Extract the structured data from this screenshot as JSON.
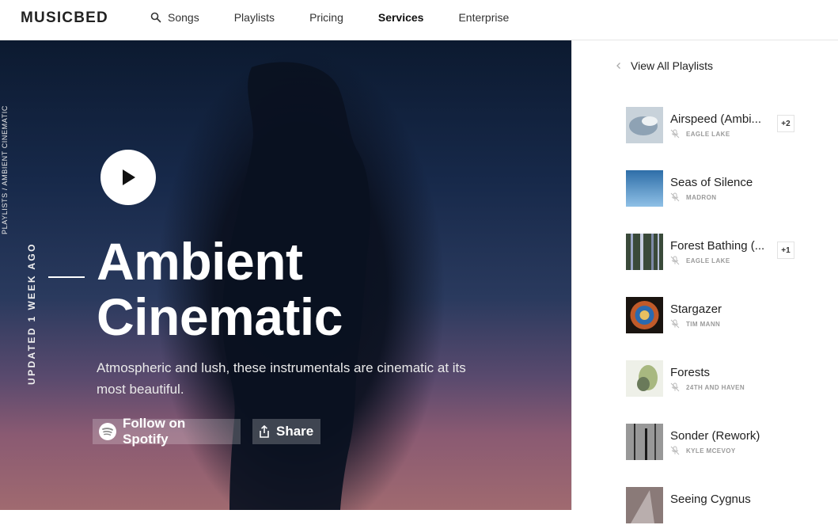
{
  "header": {
    "logo": "MUSICBED",
    "nav": [
      {
        "label": "Songs",
        "icon": "search-icon"
      },
      {
        "label": "Playlists"
      },
      {
        "label": "Pricing"
      },
      {
        "label": "Services"
      },
      {
        "label": "Enterprise"
      }
    ]
  },
  "hero": {
    "breadcrumb": "PLAYLISTS / AMBIENT CINEMATIC",
    "updated": "UPDATED 1 WEEK AGO",
    "title_line1": "Ambient",
    "title_line2": "Cinematic",
    "description": "Atmospheric and lush, these instrumentals are cinematic at its most beautiful.",
    "follow_label": "Follow on Spotify",
    "share_label": "Share"
  },
  "sidebar": {
    "back_label": "View All Playlists",
    "tracks": [
      {
        "name": "Airspeed (Ambi...",
        "artist": "EAGLE LAKE",
        "badge": "+2"
      },
      {
        "name": "Seas of Silence",
        "artist": "MADRON",
        "badge": ""
      },
      {
        "name": "Forest Bathing (...",
        "artist": "EAGLE LAKE",
        "badge": "+1"
      },
      {
        "name": "Stargazer",
        "artist": "TIM MANN",
        "badge": ""
      },
      {
        "name": "Forests",
        "artist": "24TH AND HAVEN",
        "badge": ""
      },
      {
        "name": "Sonder (Rework)",
        "artist": "KYLE MCEVOY",
        "badge": ""
      },
      {
        "name": "Seeing Cygnus",
        "artist": "",
        "badge": ""
      }
    ]
  },
  "colors": {
    "accent": "#ffffff",
    "text": "#222222",
    "muted": "#9a9a9a"
  }
}
